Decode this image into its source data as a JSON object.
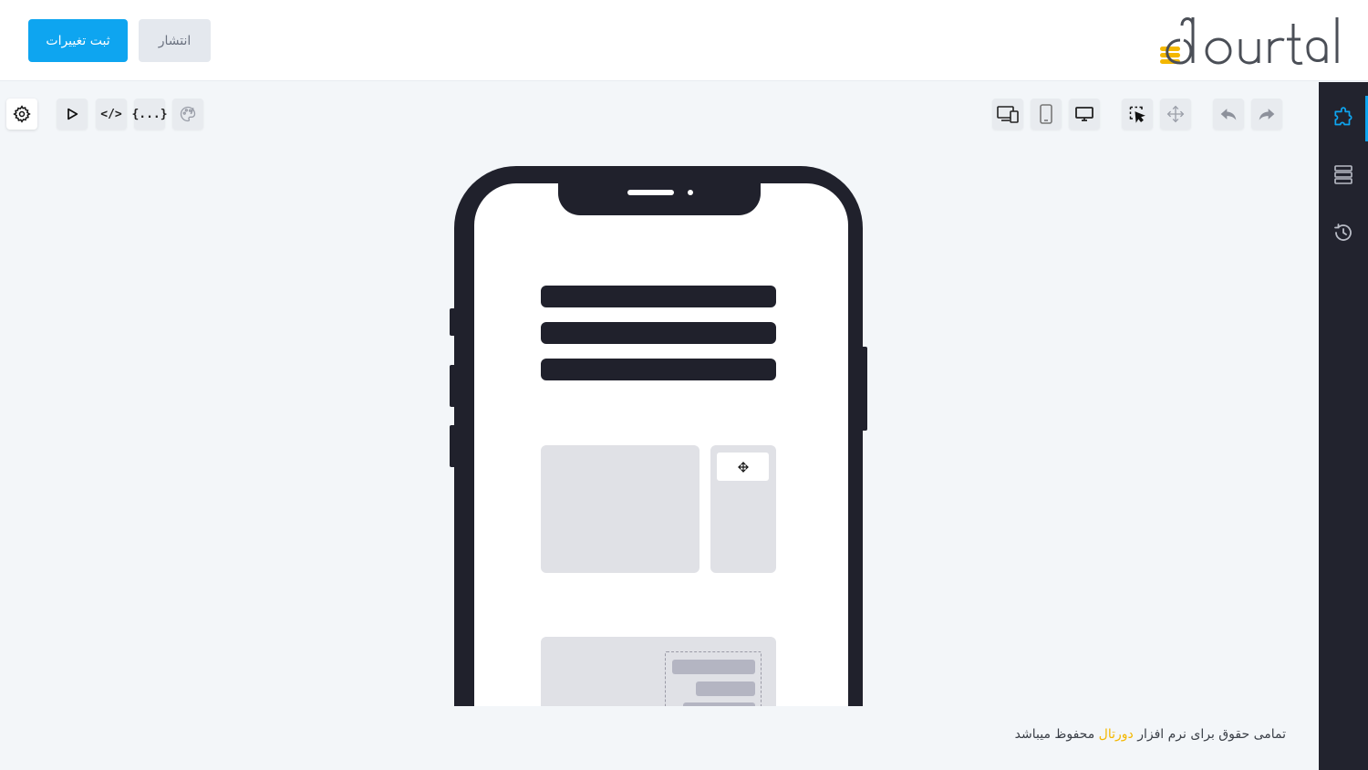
{
  "header": {
    "save_label": "ثبت تغییرات",
    "publish_label": "انتشار",
    "logo_text": "dourtal"
  },
  "sidebar": {
    "items": [
      {
        "icon": "puzzle-icon",
        "active": true
      },
      {
        "icon": "layers-icon",
        "active": false
      },
      {
        "icon": "history-icon",
        "active": false
      }
    ]
  },
  "toolbar": {
    "left": [
      {
        "icon": "settings-icon"
      },
      {
        "icon": "play-icon"
      },
      {
        "icon": "code-icon",
        "label": "</>"
      },
      {
        "icon": "json-icon",
        "label": "{...}"
      },
      {
        "icon": "palette-icon"
      }
    ],
    "right": [
      {
        "icon": "responsive-view-icon"
      },
      {
        "icon": "mobile-view-icon"
      },
      {
        "icon": "desktop-view-icon"
      },
      {
        "icon": "select-tool-icon"
      },
      {
        "icon": "move-tool-icon"
      },
      {
        "icon": "undo-icon"
      },
      {
        "icon": "redo-icon"
      }
    ]
  },
  "footer": {
    "prefix": "تمامی حقوق برای نرم افزار",
    "brand": "دورتال",
    "suffix": "محفوظ میباشد"
  },
  "colors": {
    "accent": "#0ea5f0",
    "brand_yellow": "#f3b700",
    "dark": "#20212c"
  }
}
